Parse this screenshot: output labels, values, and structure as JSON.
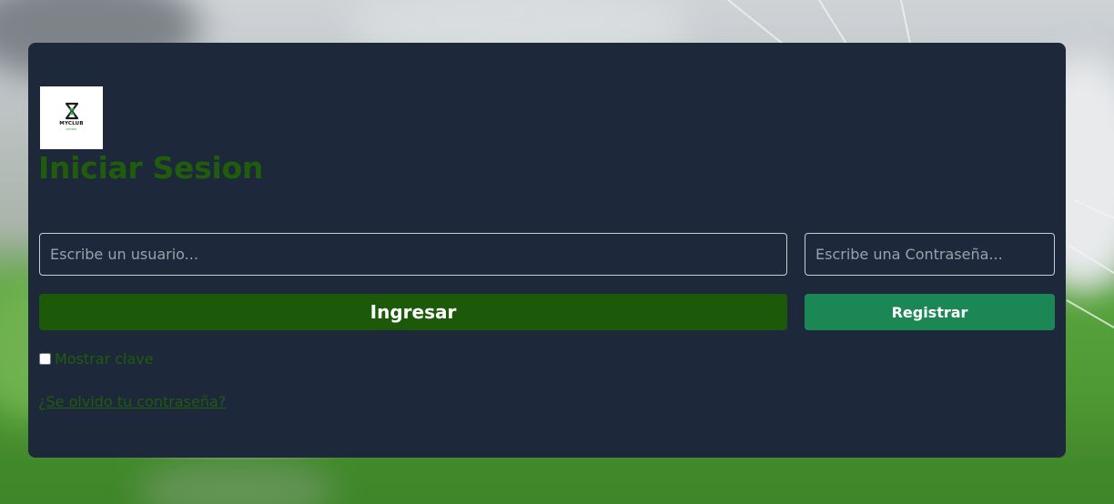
{
  "brand": {
    "logo_name": "MYCLUB",
    "logo_tagline": "SPORTS"
  },
  "login": {
    "title": "Iniciar Sesion",
    "username_placeholder": "Escribe un usuario...",
    "username_value": "",
    "password_placeholder": "Escribe una Contraseña...",
    "password_value": "",
    "login_button": "Ingresar",
    "register_button": "Registrar",
    "show_password_label": "Mostrar clave",
    "show_password_checked": false,
    "forgot_password_link": "¿Se olvido tu contraseña?"
  },
  "colors": {
    "card_background": "#1e283b",
    "accent_green_dark": "#1c5a0a",
    "accent_green_register": "#1a8755",
    "title_green": "#1f5c0c"
  },
  "icons": {
    "logo": "myclub-logo-icon"
  }
}
